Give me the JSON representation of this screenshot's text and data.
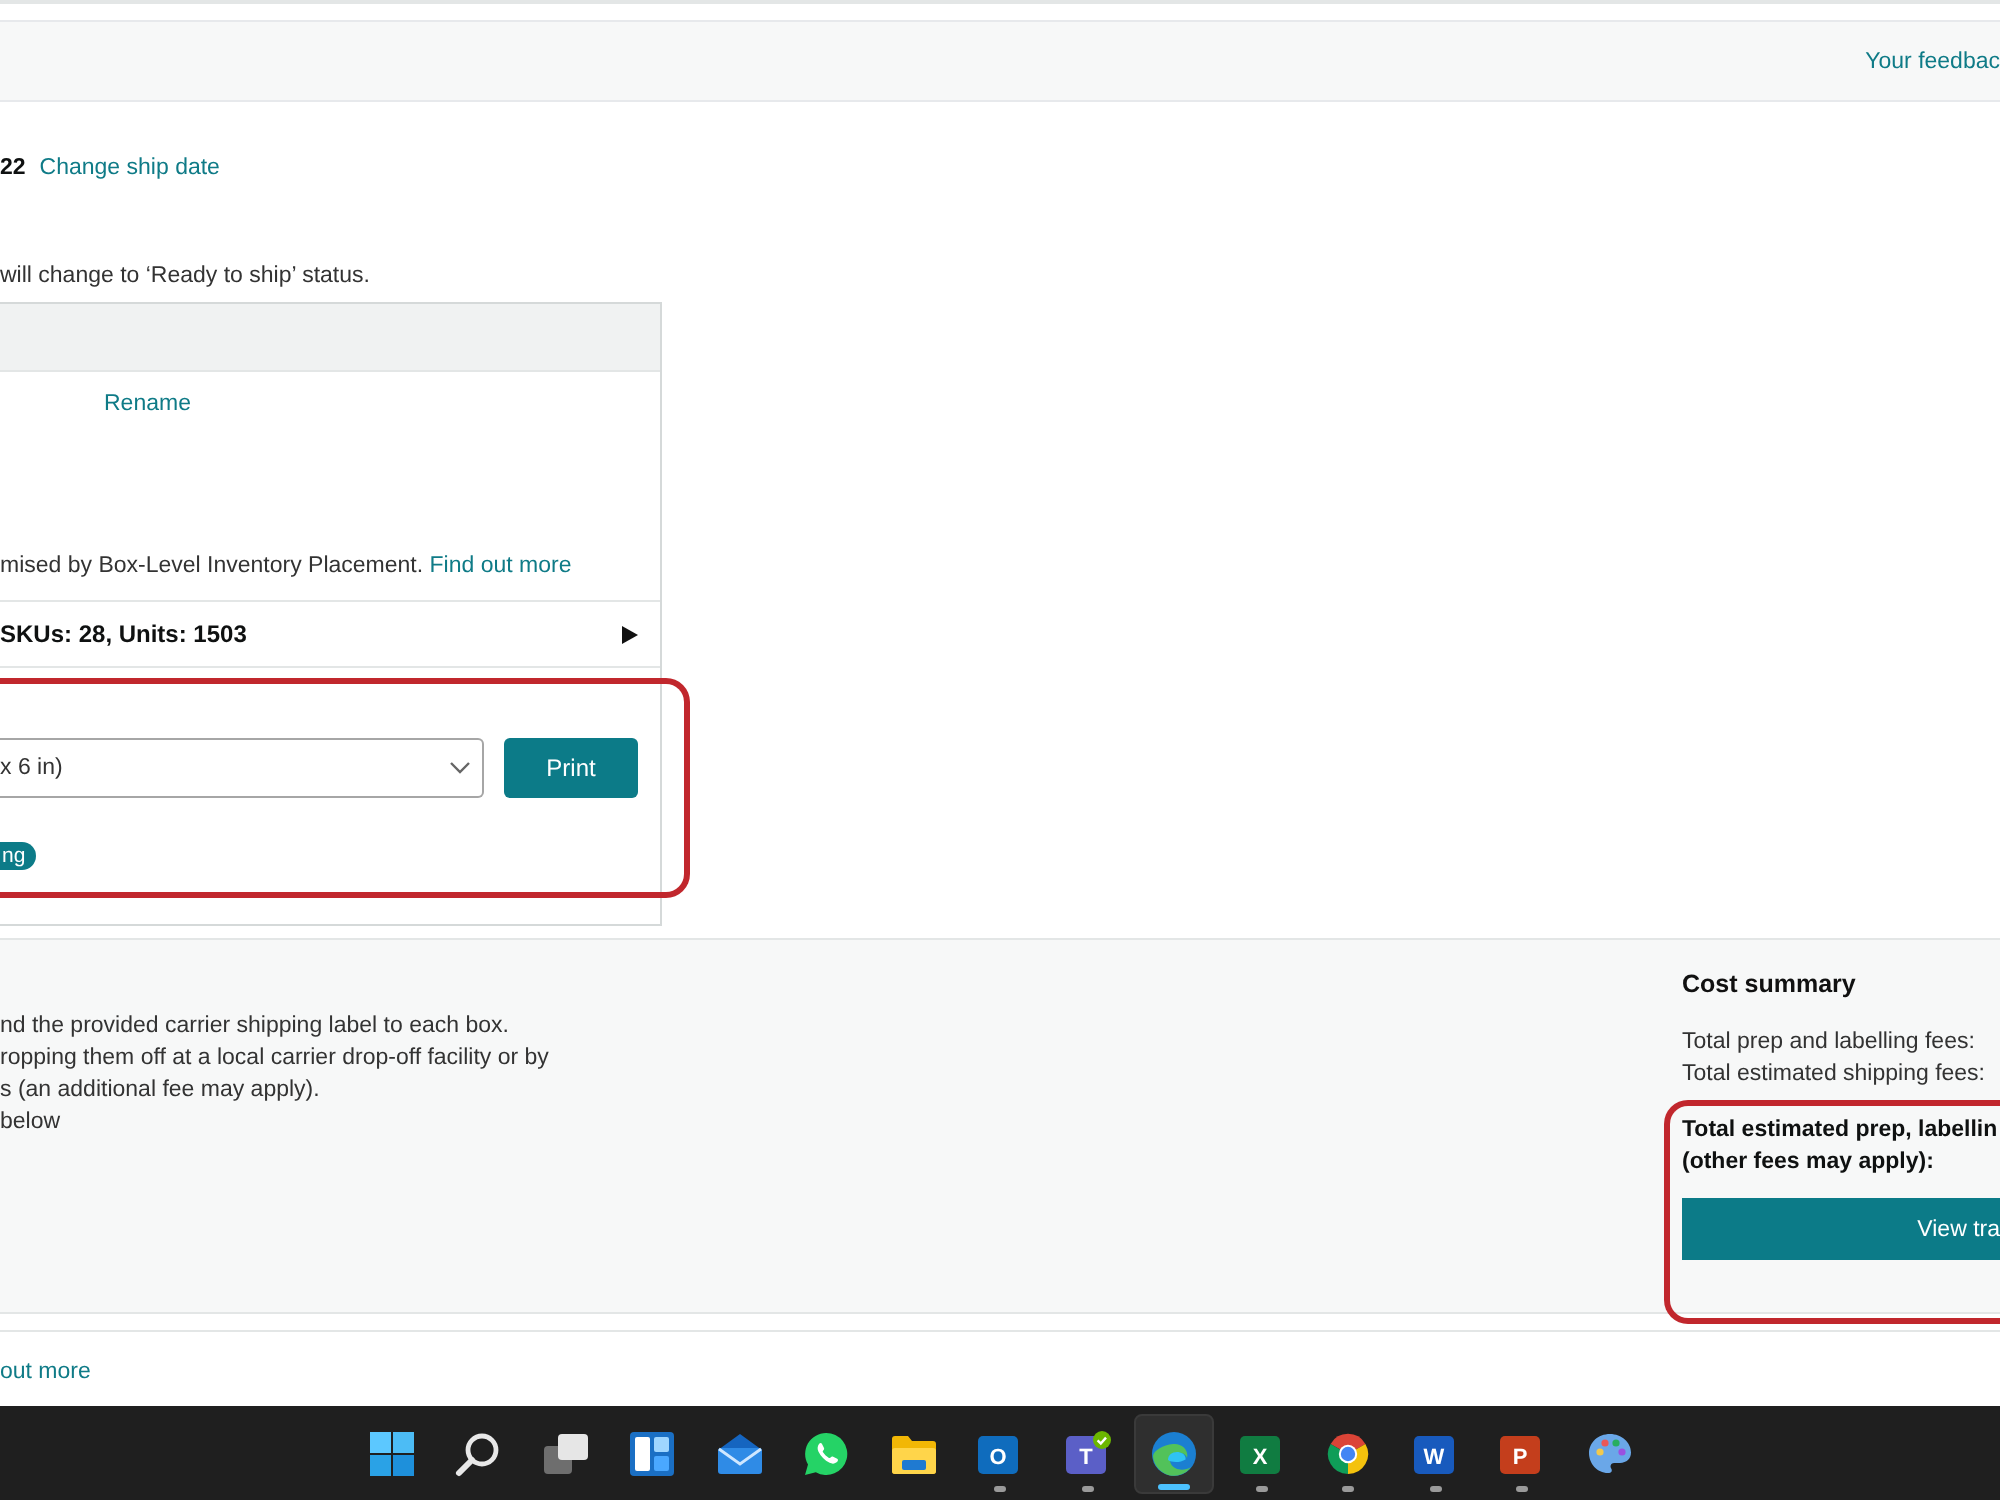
{
  "top_bar": {
    "feedback_link": "Your feedbac"
  },
  "ship_date": {
    "value": "22",
    "change_link": "Change ship date"
  },
  "status_note": "will change to ‘Ready to ship’ status.",
  "shipment_card": {
    "rename_link": "Rename",
    "note": "mised by Box-Level Inventory Placement.",
    "note_link": "Find out more",
    "contents_summary": "SKUs: 28, Units: 1503",
    "contents_expanded": false,
    "label_select": {
      "value": "x 6 in)"
    },
    "print_button": "Print",
    "status_badge": "ng",
    "highlighted": true
  },
  "instructions": {
    "lines": [
      "nd the provided carrier shipping label to each box.",
      "ropping them off at a local carrier drop-off facility or by",
      "s (an additional fee may apply).",
      "below"
    ]
  },
  "cost_summary": {
    "title": "Cost summary",
    "lines": [
      "Total prep and labelling fees:",
      "Total estimated shipping fees:"
    ],
    "total_label": "Total estimated prep, labellin",
    "total_note": "(other fees may apply):",
    "button": "View tra",
    "highlighted": true
  },
  "footer": {
    "link": "out more"
  },
  "taskbar": {
    "items": [
      {
        "kind": "start",
        "selected": false,
        "running": false
      },
      {
        "kind": "search",
        "selected": false,
        "running": false
      },
      {
        "kind": "task-view",
        "selected": false,
        "running": false
      },
      {
        "kind": "widgets",
        "selected": false,
        "running": false
      },
      {
        "kind": "mail",
        "selected": false,
        "running": false
      },
      {
        "kind": "chat",
        "selected": false,
        "running": false
      },
      {
        "kind": "folder",
        "selected": false,
        "running": false
      },
      {
        "kind": "tile",
        "letter": "O",
        "color": "#0f6cbd",
        "badge": false,
        "selected": false,
        "running": true
      },
      {
        "kind": "tile",
        "letter": "T",
        "color": "#5b5fc7",
        "badge": true,
        "selected": false,
        "running": true
      },
      {
        "kind": "swirl",
        "selected": true,
        "running": true
      },
      {
        "kind": "tile",
        "letter": "X",
        "color": "#107c41",
        "badge": false,
        "selected": false,
        "running": true
      },
      {
        "kind": "tricolor",
        "selected": false,
        "running": true
      },
      {
        "kind": "tile",
        "letter": "W",
        "color": "#185abd",
        "badge": false,
        "selected": false,
        "running": true
      },
      {
        "kind": "tile",
        "letter": "P",
        "color": "#c43e1c",
        "badge": false,
        "selected": false,
        "running": true
      },
      {
        "kind": "palette",
        "selected": false,
        "running": false
      }
    ]
  }
}
